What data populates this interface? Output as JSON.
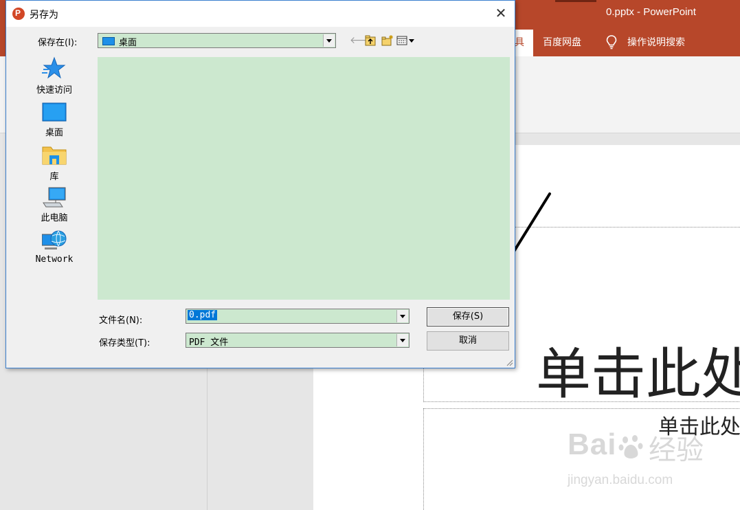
{
  "powerpoint": {
    "window_title": "0.pptx  -  PowerPoint",
    "tab_partial": "具",
    "tabs": [
      "百度网盘",
      "操作说明搜索"
    ],
    "slide_title_placeholder": "单击此处",
    "slide_subtitle_placeholder": "单击此处"
  },
  "dialog": {
    "title": "另存为",
    "close_label": "✕",
    "save_in_label": "保存在(I):",
    "save_in_value": "桌面",
    "places": [
      {
        "label": "快速访问",
        "icon": "star-icon"
      },
      {
        "label": "桌面",
        "icon": "desktop-icon"
      },
      {
        "label": "库",
        "icon": "library-folder-icon"
      },
      {
        "label": "此电脑",
        "icon": "computer-icon"
      },
      {
        "label": "Network",
        "icon": "network-icon"
      }
    ],
    "filename_label": "文件名(N):",
    "filename_value": "0.pdf",
    "filetype_label": "保存类型(T):",
    "filetype_value": "PDF 文件",
    "save_button": "保存(S)",
    "cancel_button": "取消"
  },
  "watermark": {
    "brand": "Bai",
    "brand2": "经验",
    "url": "jingyan.baidu.com"
  },
  "colors": {
    "ppt_accent": "#b7472a",
    "list_background": "#cce8cf",
    "selection": "#0078d7"
  }
}
